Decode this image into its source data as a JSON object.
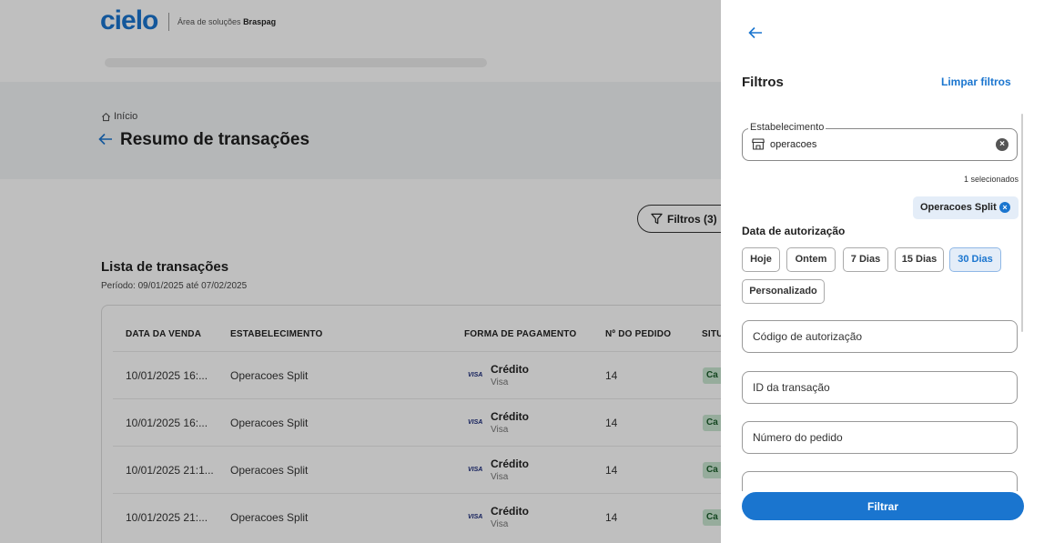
{
  "brand": {
    "logo": "cielo",
    "subtitle_prefix": "Área de soluções",
    "subtitle_brand": "Braspag"
  },
  "breadcrumb": "Início",
  "page_title": "Resumo de transações",
  "filters_button": "Filtros (3)",
  "list": {
    "title": "Lista de transações",
    "period": "Período: 09/01/2025 até 07/02/2025",
    "columns": [
      "DATA DA VENDA",
      "ESTABELECIMENTO",
      "FORMA DE PAGAMENTO",
      "Nº DO PEDIDO",
      "SITU"
    ],
    "rows": [
      {
        "date": "10/01/2025 16:...",
        "establishment": "Operacoes Split",
        "brand": "VISA",
        "payment": "Crédito",
        "payment_sub": "Visa",
        "order": "14",
        "status": "Ca"
      },
      {
        "date": "10/01/2025 16:...",
        "establishment": "Operacoes Split",
        "brand": "VISA",
        "payment": "Crédito",
        "payment_sub": "Visa",
        "order": "14",
        "status": "Ca"
      },
      {
        "date": "10/01/2025 21:1...",
        "establishment": "Operacoes Split",
        "brand": "VISA",
        "payment": "Crédito",
        "payment_sub": "Visa",
        "order": "14",
        "status": "Ca"
      },
      {
        "date": "10/01/2025 21:...",
        "establishment": "Operacoes Split",
        "brand": "VISA",
        "payment": "Crédito",
        "payment_sub": "Visa",
        "order": "14",
        "status": "Ca"
      }
    ]
  },
  "drawer": {
    "title": "Filtros",
    "clear_label": "Limpar filtros",
    "establishment": {
      "label": "Estabelecimento",
      "value": "operacoes",
      "selected_count": "1 selecionados",
      "selected_chip": "Operacoes Split"
    },
    "auth_date": {
      "label": "Data de autorização",
      "options": [
        "Hoje",
        "Ontem",
        "7 Dias",
        "15 Dias",
        "30 Dias",
        "Personalizado"
      ],
      "active": "30 Dias"
    },
    "fields": {
      "auth_code": "Código de autorização",
      "transaction_id": "ID da transação",
      "order_number": "Número do pedido"
    },
    "submit_label": "Filtrar"
  },
  "colors": {
    "primary": "#1a75cf",
    "chip_bg": "#e4edf8"
  }
}
